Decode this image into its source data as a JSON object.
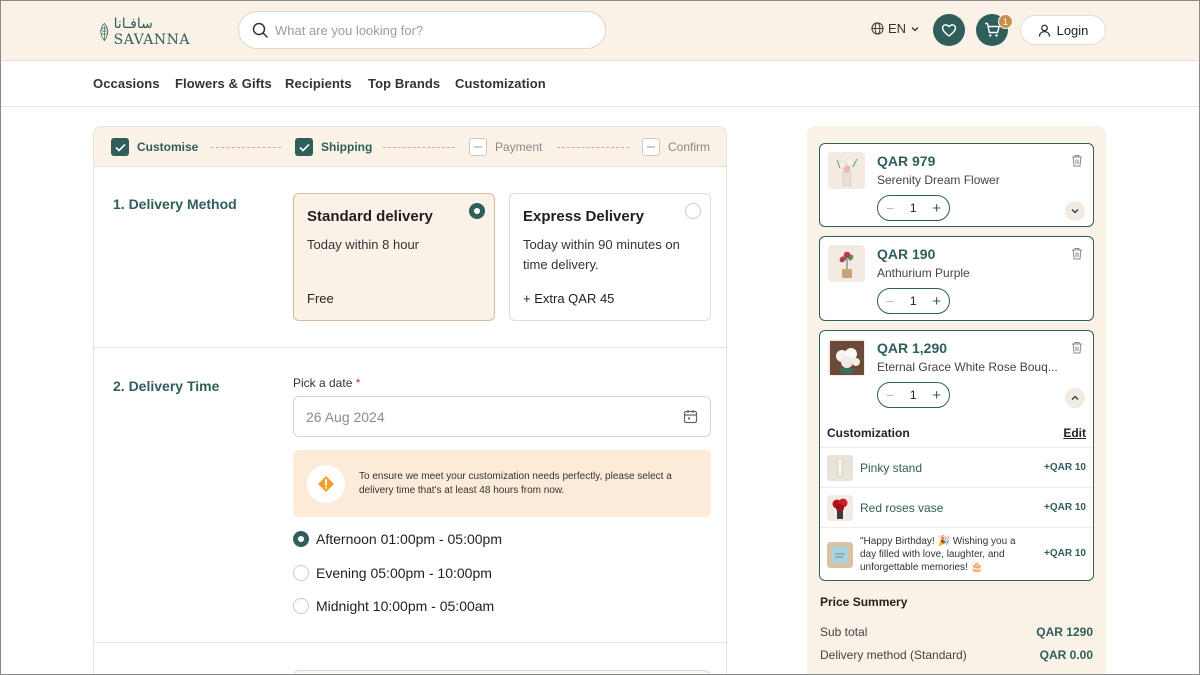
{
  "brand": {
    "name_ar": "سافـانا",
    "name_en": "SAVANNA"
  },
  "search": {
    "placeholder": "What are you looking for?"
  },
  "header": {
    "language": "EN",
    "cart_count": "1",
    "login_label": "Login"
  },
  "nav": {
    "items": [
      "Occasions",
      "Flowers & Gifts",
      "Recipients",
      "Top Brands",
      "Customization"
    ]
  },
  "steps": [
    {
      "label": "Customise",
      "done": true
    },
    {
      "label": "Shipping",
      "done": true
    },
    {
      "label": "Payment",
      "done": false
    },
    {
      "label": "Confirm",
      "done": false
    }
  ],
  "delivery_method": {
    "title": "1. Delivery Method",
    "options": [
      {
        "title": "Standard delivery",
        "desc": "Today within 8 hour",
        "price": "Free",
        "selected": true
      },
      {
        "title": "Express Delivery",
        "desc": "Today within 90 minutes on time delivery.",
        "price": "+ Extra QAR 45",
        "selected": false
      }
    ]
  },
  "delivery_time": {
    "title": "2. Delivery Time",
    "date_label": "Pick a date",
    "required_mark": "*",
    "date_value": "26 Aug 2024",
    "notice": "To ensure we meet your customization needs perfectly, please select a delivery time that's at least 48 hours from now.",
    "slots": [
      {
        "label": "Afternoon 01:00pm - 05:00pm",
        "selected": true
      },
      {
        "label": "Evening 05:00pm - 10:00pm",
        "selected": false
      },
      {
        "label": "Midnight 10:00pm - 05:00am",
        "selected": false
      }
    ]
  },
  "cart": {
    "items": [
      {
        "price": "QAR 979",
        "name": "Serenity Dream Flower",
        "qty": "1"
      },
      {
        "price": "QAR 190",
        "name": "Anthurium Purple",
        "qty": "1"
      },
      {
        "price": "QAR 1,290",
        "name": "Eternal Grace White Rose Bouq...",
        "qty": "1"
      }
    ],
    "customization": {
      "title": "Customization",
      "edit_label": "Edit",
      "rows": [
        {
          "name": "Pinky stand",
          "price": "+QAR 10"
        },
        {
          "name": "Red roses vase",
          "price": "+QAR 10"
        },
        {
          "message": "\"Happy Birthday! 🎉 Wishing you a day filled with love, laughter, and unforgettable memories! 🎂",
          "price": "+QAR 10"
        }
      ]
    },
    "summary": {
      "title": "Price Summery",
      "rows": [
        {
          "label": "Sub total",
          "value": "QAR 1290"
        },
        {
          "label": "Delivery method (Standard)",
          "value": "QAR 0.00"
        }
      ]
    }
  },
  "colors": {
    "primary": "#2f5e5b",
    "cream": "#faf1e7",
    "accent": "#c8904d",
    "notice_bg": "#fcebd9",
    "notice_icon": "#f0a030"
  }
}
